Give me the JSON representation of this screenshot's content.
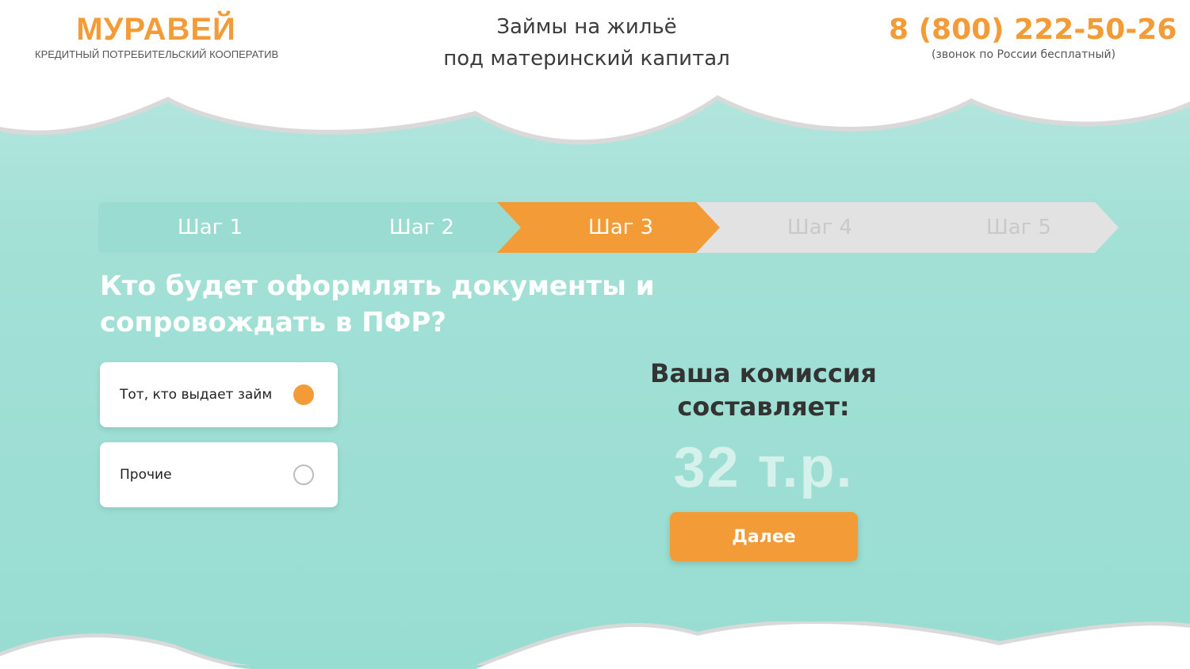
{
  "header": {
    "logo_title": "МУРАВЕЙ",
    "logo_subtitle": "КРЕДИТНЫЙ ПОТРЕБИТЕЛЬСКИЙ КООПЕРАТИВ",
    "tagline_line1": "Займы на жильё",
    "tagline_line2": "под материнский капитал",
    "phone": "8 (800) 222-50-26",
    "phone_note": "(звонок по России бесплатный)"
  },
  "steps": [
    {
      "label": "Шаг 1",
      "state": "done"
    },
    {
      "label": "Шаг 2",
      "state": "done"
    },
    {
      "label": "Шаг 3",
      "state": "active"
    },
    {
      "label": "Шаг 4",
      "state": "todo"
    },
    {
      "label": "Шаг 5",
      "state": "todo"
    }
  ],
  "question": "Кто будет оформлять документы и сопровождать в ПФР?",
  "options": [
    {
      "label": "Тот, кто выдает займ",
      "selected": true
    },
    {
      "label": "Прочие",
      "selected": false
    }
  ],
  "commission": {
    "label_line1": "Ваша комиссия",
    "label_line2": "составляет:",
    "value": "32 т.р."
  },
  "next_button": "Далее",
  "colors": {
    "accent": "#f39c37",
    "teal_light": "#bce9e2",
    "teal": "#98ddd2",
    "step_done": "#9bdcd2",
    "step_todo": "#e2e2e2"
  }
}
